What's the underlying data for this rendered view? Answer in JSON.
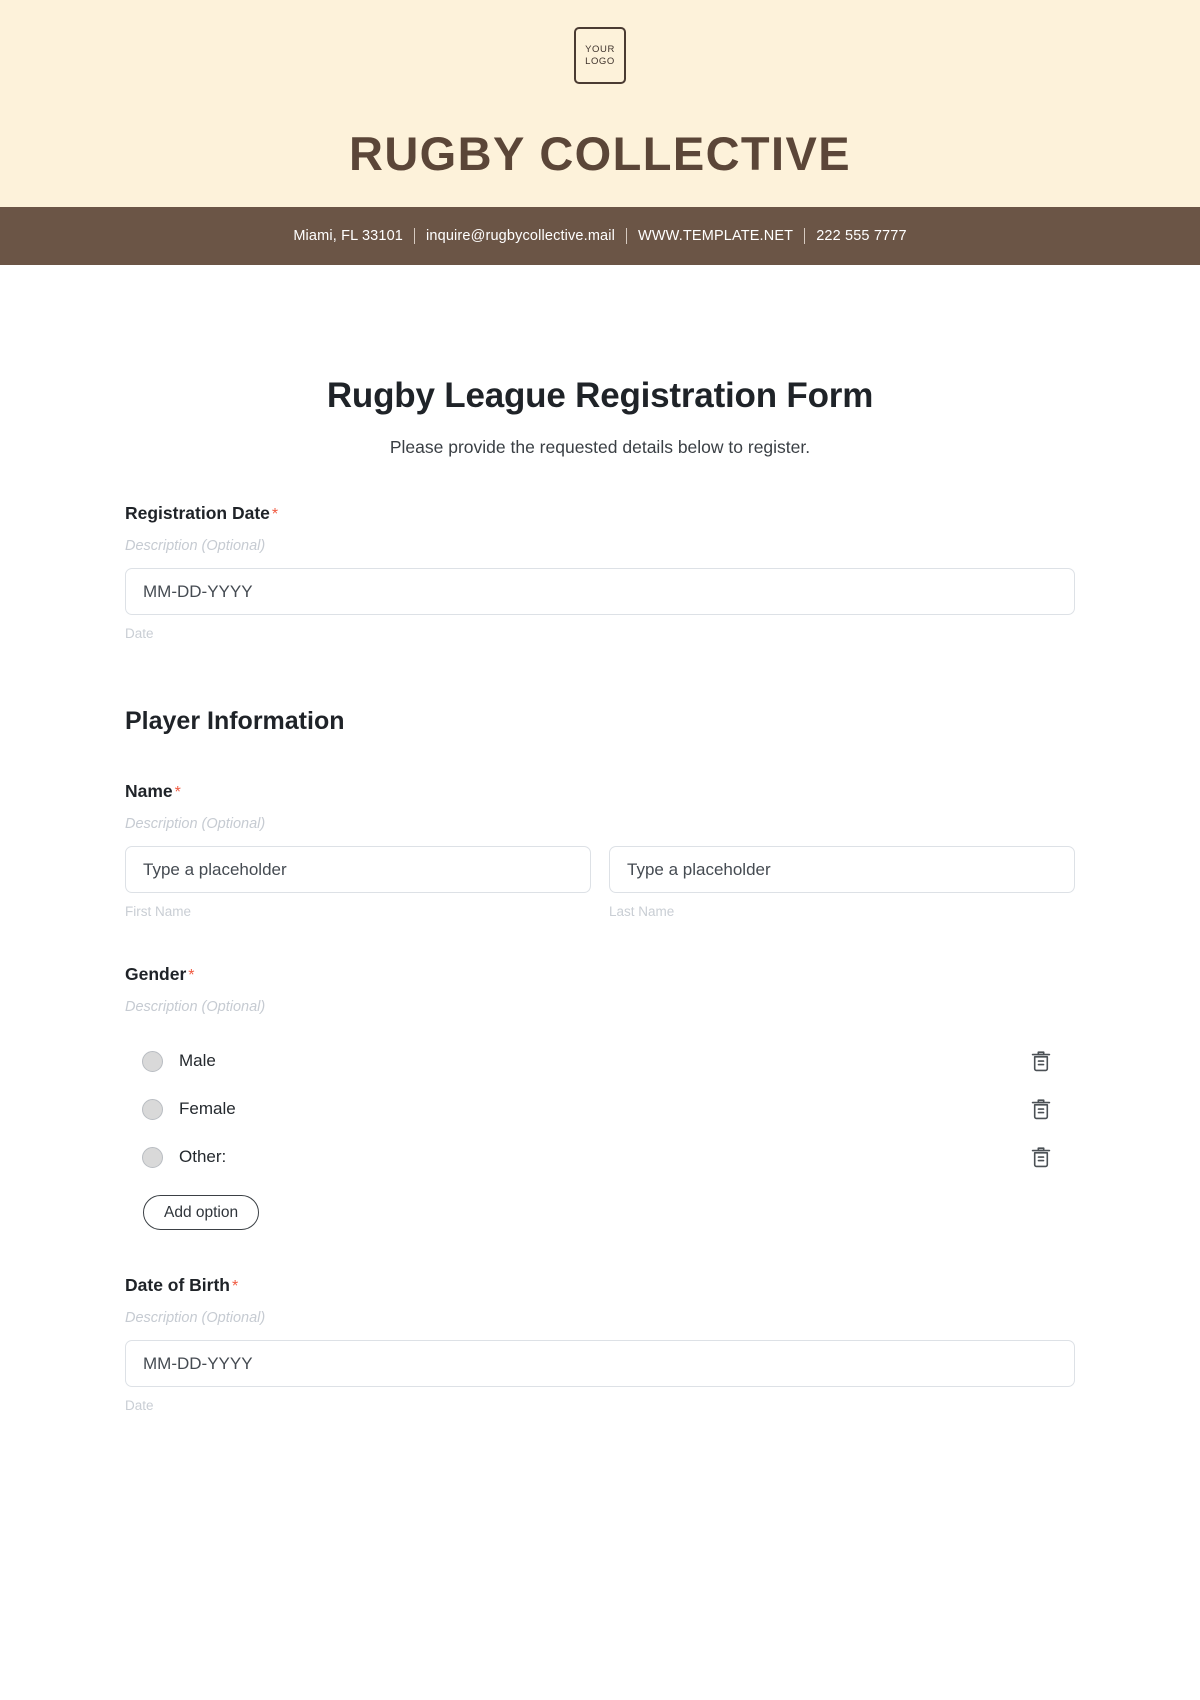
{
  "letterhead": {
    "logo": {
      "line1": "YOUR",
      "line2": "LOGO"
    },
    "brand_title": "RUGBY COLLECTIVE",
    "contact": {
      "address": "Miami, FL 33101",
      "email": "inquire@rugbycollective.mail",
      "website": "WWW.TEMPLATE.NET",
      "phone": "222 555 7777"
    },
    "colors": {
      "header_bg": "#FDF2DA",
      "contact_bar_bg": "#6B5546",
      "brand_text": "#5B4638"
    }
  },
  "form": {
    "title": "Rugby League Registration Form",
    "subtitle": "Please provide the requested details below to register.",
    "required_marker": "*",
    "required_color": "#F05A41",
    "fields": [
      {
        "label": "Registration Date",
        "required": true,
        "description": "Description (Optional)",
        "placeholder": "MM-DD-YYYY",
        "helper": "Date"
      }
    ],
    "section": {
      "heading": "Player Information",
      "name_field": {
        "label": "Name",
        "required": true,
        "description": "Description (Optional)",
        "first": {
          "placeholder": "Type a placeholder",
          "helper": "First Name"
        },
        "last": {
          "placeholder": "Type a placeholder",
          "helper": "Last Name"
        }
      },
      "gender_field": {
        "label": "Gender",
        "required": true,
        "description": "Description (Optional)",
        "options": [
          {
            "label": "Male",
            "delete_icon": "trash-icon"
          },
          {
            "label": "Female",
            "delete_icon": "trash-icon"
          },
          {
            "label": "Other:",
            "delete_icon": "trash-icon"
          }
        ],
        "add_option_label": "Add option"
      },
      "dob_field": {
        "label": "Date of Birth",
        "required": true,
        "description": "Description (Optional)",
        "placeholder": "MM-DD-YYYY",
        "helper": "Date"
      }
    }
  }
}
